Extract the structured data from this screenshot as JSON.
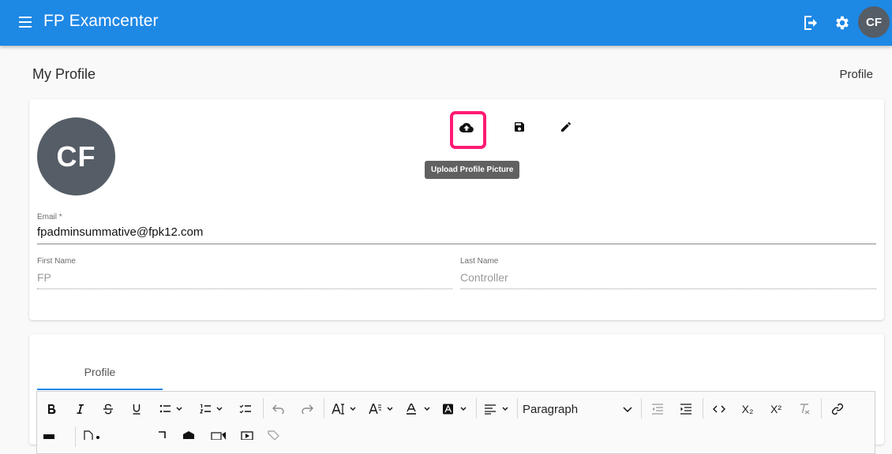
{
  "app": {
    "title": "FP Examcenter",
    "avatar_initials": "CF"
  },
  "page": {
    "title": "My Profile",
    "breadcrumb": "Profile"
  },
  "profile": {
    "avatar_initials": "CF",
    "tooltip": "Upload Profile Picture",
    "email_label": "Email *",
    "email_value": "fpadminsummative@fpk12.com",
    "first_name_label": "First Name",
    "first_name_value": "FP",
    "last_name_label": "Last Name",
    "last_name_value": "Controller"
  },
  "editor": {
    "tab_label": "Profile",
    "paragraph_select": "Paragraph",
    "subscript_label": "X₂",
    "superscript_label": "X²"
  },
  "icons": {
    "menu": "menu-icon",
    "logout": "logout-icon",
    "settings": "gear-icon",
    "upload": "cloud-upload-icon",
    "save": "save-icon",
    "edit": "pencil-icon"
  },
  "colors": {
    "appbar": "#1e88e5",
    "avatar": "#555d66",
    "highlight": "#ff1a73",
    "tooltip": "#616161"
  }
}
